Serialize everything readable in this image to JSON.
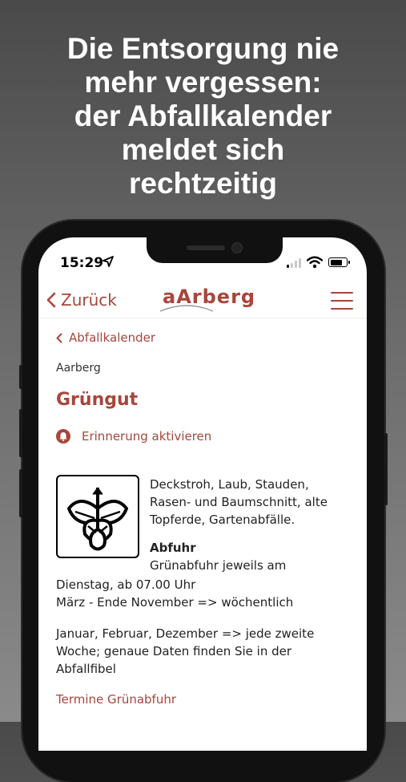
{
  "headline": [
    "Die Entsorgung nie",
    "mehr vergessen:",
    "der Abfallkalender",
    "meldet sich",
    "rechtzeitig"
  ],
  "status_bar": {
    "time": "15:29"
  },
  "header": {
    "back_label": "Zurück",
    "logo_text": "aArberg"
  },
  "breadcrumb": {
    "label": "Abfallkalender"
  },
  "location": "Aarberg",
  "page_title": "Grüngut",
  "reminder_label": "Erinnerung aktivieren",
  "description": [
    "Deckstroh, Laub, Stauden,",
    "Rasen- und Baumschnitt, alte",
    "Topferde, Gartenabfälle."
  ],
  "abfuhr": {
    "heading": "Abfuhr",
    "line1": "Grünabfuhr jeweils am",
    "line2": "Dienstag, ab 07.00 Uhr",
    "line3": "März - Ende November => wöchentlich"
  },
  "extra": [
    "Januar, Februar, Dezember => jede zweite",
    "Woche; genaue Daten finden Sie in der",
    "Abfallfibel"
  ],
  "link_label": "Termine Grünabfuhr",
  "colors": {
    "accent": "#a8463b",
    "background_top": "#4a4a4a",
    "background_bottom": "#8a8a8a"
  },
  "icons": [
    "location-arrow-icon",
    "signal-icon",
    "wifi-icon",
    "battery-icon",
    "chevron-left-icon",
    "hamburger-menu-icon",
    "bell-icon",
    "green-waste-leaf-icon"
  ]
}
